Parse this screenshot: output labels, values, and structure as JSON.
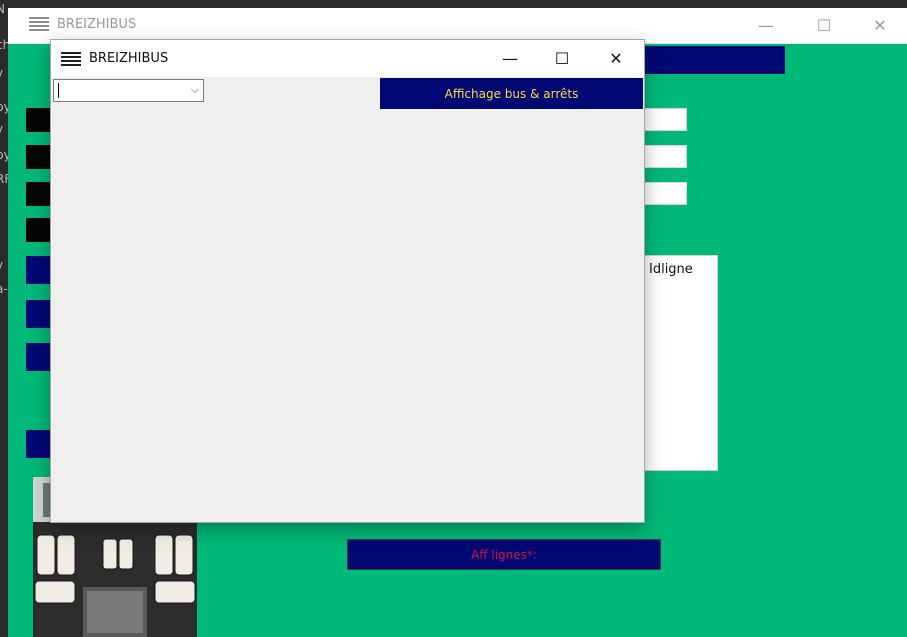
{
  "background_window": {
    "title": "BREIZHIBUS",
    "controls": {
      "minimize": "—",
      "maximize": "☐",
      "close": "✕"
    },
    "list_header": "Idligne",
    "aff_lignes_label": "Aff lignes*:"
  },
  "dialog": {
    "title": "BREIZHIBUS",
    "controls": {
      "minimize": "—",
      "maximize": "☐",
      "close": "✕"
    },
    "combo_value": "",
    "combo_arrow": "⌵",
    "show_button_label": "Affichage bus & arrêts"
  },
  "desktop_strip": [
    "N",
    "ch",
    "y",
    "py",
    "y",
    "py",
    "RF",
    "y",
    "a-"
  ],
  "colors": {
    "green": "#00b877",
    "navy": "#020873",
    "yellow_text": "#ffd84a",
    "red_text": "#d4123f"
  }
}
